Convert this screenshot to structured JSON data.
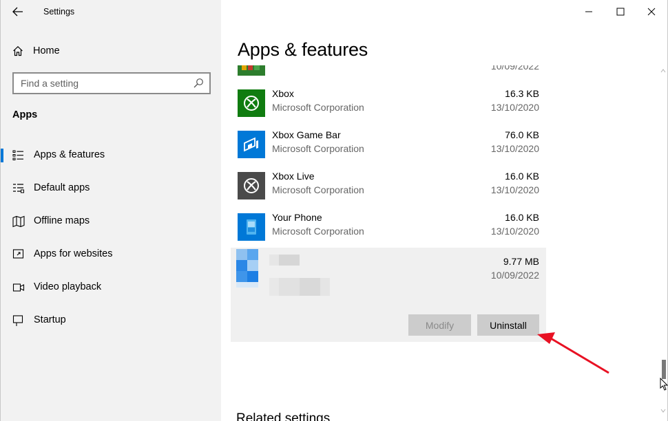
{
  "window": {
    "title": "Settings"
  },
  "sidebar": {
    "home_label": "Home",
    "search_placeholder": "Find a setting",
    "section_title": "Apps",
    "items": [
      {
        "label": "Apps & features",
        "icon": "apps-list-icon",
        "active": true
      },
      {
        "label": "Default apps",
        "icon": "default-apps-icon",
        "active": false
      },
      {
        "label": "Offline maps",
        "icon": "map-icon",
        "active": false
      },
      {
        "label": "Apps for websites",
        "icon": "link-window-icon",
        "active": false
      },
      {
        "label": "Video playback",
        "icon": "video-icon",
        "active": false
      },
      {
        "label": "Startup",
        "icon": "startup-icon",
        "active": false
      }
    ]
  },
  "main": {
    "page_title": "Apps & features",
    "partial_row_date": "10/09/2022",
    "apps": [
      {
        "name": "Xbox",
        "publisher": "Microsoft Corporation",
        "size": "16.3 KB",
        "date": "13/10/2020",
        "tile_color": "#107c10",
        "icon": "xbox-logo-icon"
      },
      {
        "name": "Xbox Game Bar",
        "publisher": "Microsoft Corporation",
        "size": "76.0 KB",
        "date": "13/10/2020",
        "tile_color": "#0078d7",
        "icon": "game-bar-icon"
      },
      {
        "name": "Xbox Live",
        "publisher": "Microsoft Corporation",
        "size": "16.0 KB",
        "date": "13/10/2020",
        "tile_color": "#4a4a4a",
        "icon": "xbox-logo-icon"
      },
      {
        "name": "Your Phone",
        "publisher": "Microsoft Corporation",
        "size": "16.0 KB",
        "date": "13/10/2020",
        "tile_color": "#0078d7",
        "icon": "phone-icon"
      }
    ],
    "selected_app": {
      "size": "9.77 MB",
      "date": "10/09/2022",
      "modify_label": "Modify",
      "uninstall_label": "Uninstall"
    },
    "related_settings_label": "Related settings"
  },
  "colors": {
    "accent": "#0078d7",
    "annotation_arrow": "#e81123"
  }
}
